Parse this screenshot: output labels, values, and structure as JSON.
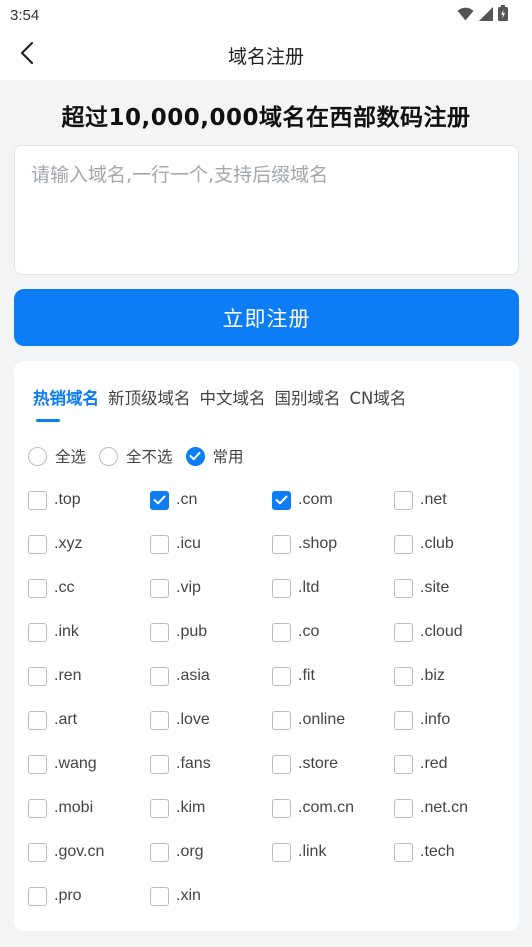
{
  "status_bar": {
    "time": "3:54",
    "icons": [
      "wifi-icon",
      "signal-icon",
      "battery-icon"
    ]
  },
  "nav": {
    "title": "域名注册",
    "back_icon": "chevron-left-icon"
  },
  "headline": "超过10,000,000域名在西部数码注册",
  "domain_input": {
    "placeholder": "请输入域名,一行一个,支持后缀域名",
    "value": ""
  },
  "register_button": "立即注册",
  "tabs": [
    {
      "label": "热销域名",
      "active": true
    },
    {
      "label": "新顶级域名",
      "active": false
    },
    {
      "label": "中文域名",
      "active": false
    },
    {
      "label": "国别域名",
      "active": false
    },
    {
      "label": "CN域名",
      "active": false
    }
  ],
  "select_options": [
    {
      "label": "全选",
      "checked": false
    },
    {
      "label": "全不选",
      "checked": false
    },
    {
      "label": "常用",
      "checked": true
    }
  ],
  "suffixes": [
    {
      "label": ".top",
      "checked": false
    },
    {
      "label": ".cn",
      "checked": true
    },
    {
      "label": ".com",
      "checked": true
    },
    {
      "label": ".net",
      "checked": false
    },
    {
      "label": ".xyz",
      "checked": false
    },
    {
      "label": ".icu",
      "checked": false
    },
    {
      "label": ".shop",
      "checked": false
    },
    {
      "label": ".club",
      "checked": false
    },
    {
      "label": ".cc",
      "checked": false
    },
    {
      "label": ".vip",
      "checked": false
    },
    {
      "label": ".ltd",
      "checked": false
    },
    {
      "label": ".site",
      "checked": false
    },
    {
      "label": ".ink",
      "checked": false
    },
    {
      "label": ".pub",
      "checked": false
    },
    {
      "label": ".co",
      "checked": false
    },
    {
      "label": ".cloud",
      "checked": false
    },
    {
      "label": ".ren",
      "checked": false
    },
    {
      "label": ".asia",
      "checked": false
    },
    {
      "label": ".fit",
      "checked": false
    },
    {
      "label": ".biz",
      "checked": false
    },
    {
      "label": ".art",
      "checked": false
    },
    {
      "label": ".love",
      "checked": false
    },
    {
      "label": ".online",
      "checked": false
    },
    {
      "label": ".info",
      "checked": false
    },
    {
      "label": ".wang",
      "checked": false
    },
    {
      "label": ".fans",
      "checked": false
    },
    {
      "label": ".store",
      "checked": false
    },
    {
      "label": ".red",
      "checked": false
    },
    {
      "label": ".mobi",
      "checked": false
    },
    {
      "label": ".kim",
      "checked": false
    },
    {
      "label": ".com.cn",
      "checked": false
    },
    {
      "label": ".net.cn",
      "checked": false
    },
    {
      "label": ".gov.cn",
      "checked": false
    },
    {
      "label": ".org",
      "checked": false
    },
    {
      "label": ".link",
      "checked": false
    },
    {
      "label": ".tech",
      "checked": false
    },
    {
      "label": ".pro",
      "checked": false
    },
    {
      "label": ".xin",
      "checked": false
    }
  ],
  "colors": {
    "accent": "#0d7df5",
    "background": "#f3f4f6",
    "card": "#ffffff"
  }
}
